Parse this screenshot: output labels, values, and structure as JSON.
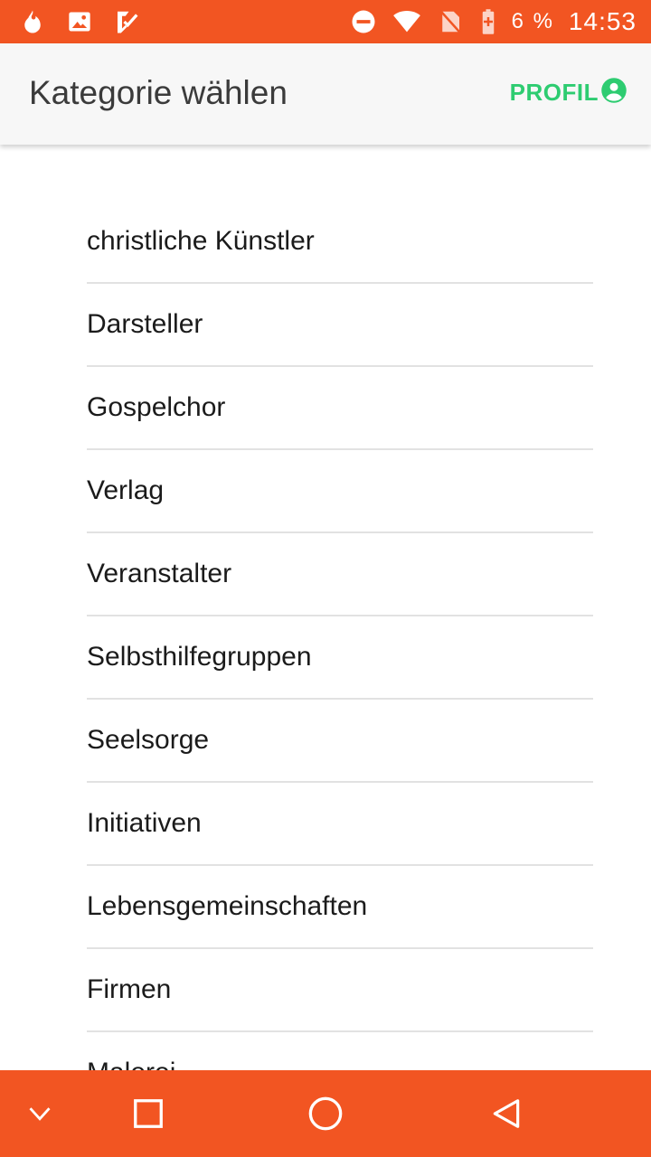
{
  "status_bar": {
    "battery_percent": "6 %",
    "time": "14:53",
    "left_icons": [
      "tinder-flame-icon",
      "image-icon",
      "task-check-icon"
    ],
    "right_icons": [
      "do-not-disturb-icon",
      "wifi-icon",
      "no-sim-icon",
      "battery-charging-icon"
    ]
  },
  "app_bar": {
    "title": "Kategorie wählen",
    "profile_label": "PROFIL",
    "accent_color": "#2ecc71",
    "background": "#f7f7f7"
  },
  "categories": [
    "christliche Künstler",
    "Darsteller",
    "Gospelchor",
    "Verlag",
    "Veranstalter",
    "Selbsthilfegruppen",
    "Seelsorge",
    "Initiativen",
    "Lebensgemeinschaften",
    "Firmen",
    "Malerei"
  ],
  "nav_bar": {
    "color": "#f25522",
    "buttons": [
      "collapse-chevron-icon",
      "recents-square-icon",
      "home-circle-icon",
      "back-triangle-icon"
    ]
  }
}
